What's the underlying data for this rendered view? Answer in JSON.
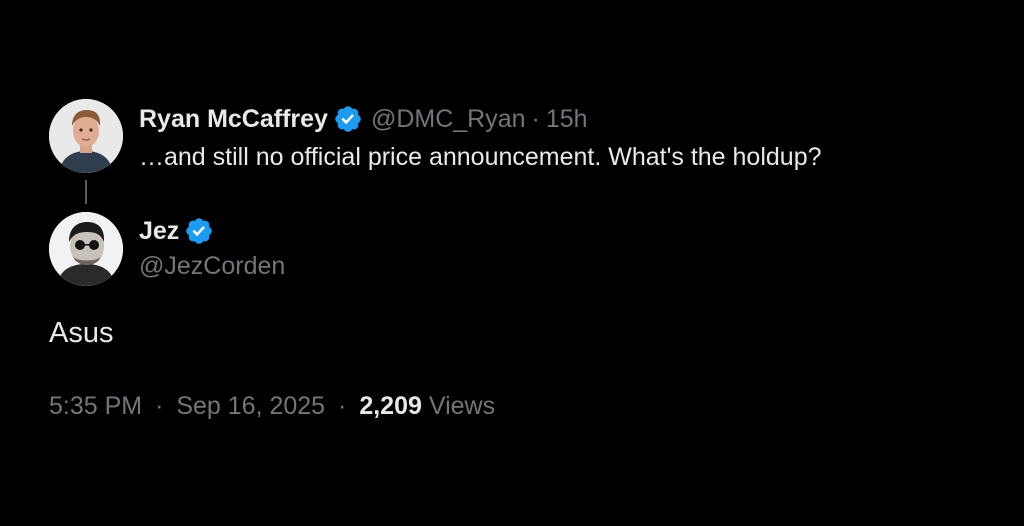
{
  "reply_tweet": {
    "author_name": "Ryan McCaffrey",
    "handle": "@DMC_Ryan",
    "separator": "·",
    "time_ago": "15h",
    "text": "…and still no official price announcement. What's the holdup?",
    "verified": true,
    "avatar_icon": "avatar-man-portrait"
  },
  "main_tweet": {
    "author_name": "Jez",
    "handle": "@JezCorden",
    "verified": true,
    "avatar_icon": "avatar-man-sunglasses-portrait",
    "text": "Asus",
    "time": "5:35 PM",
    "separator": "·",
    "date": "Sep 16, 2025",
    "views_count": "2,209",
    "views_label": "Views"
  },
  "colors": {
    "background": "#000000",
    "primary_text": "#e7e9ea",
    "secondary_text": "#71767b",
    "verified_badge": "#1d9bf0",
    "thread_line": "#5b5e61"
  }
}
